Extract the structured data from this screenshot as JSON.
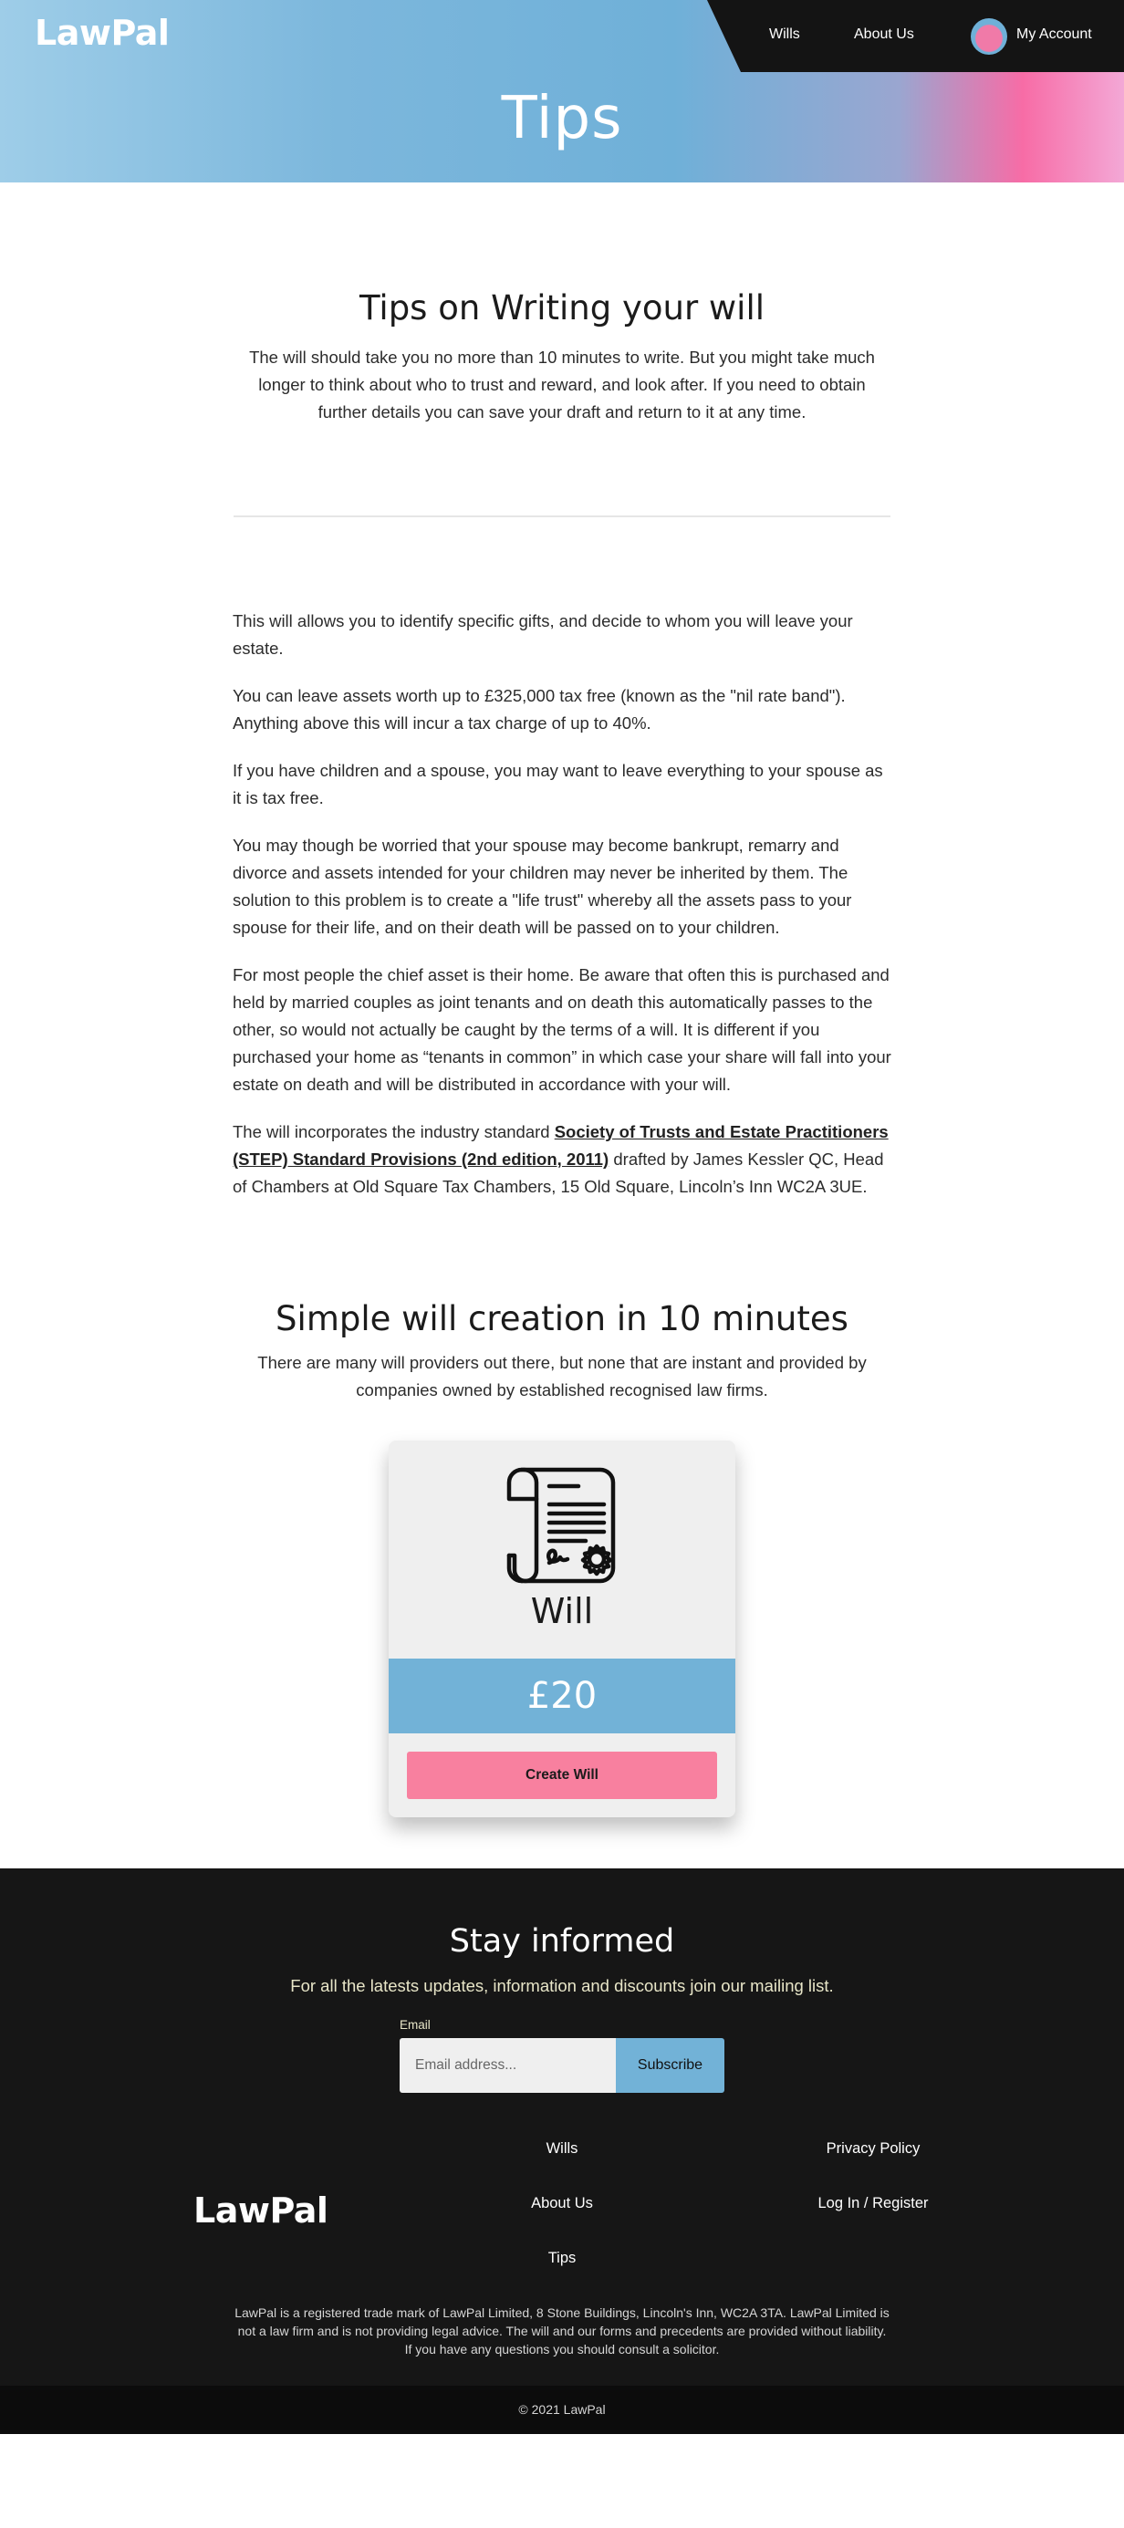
{
  "header": {
    "logo": "LawPal",
    "nav": {
      "wills": "Wills",
      "about": "About Us",
      "account": "My Account"
    },
    "page_title": "Tips"
  },
  "intro": {
    "heading": "Tips on Writing your will",
    "text": "The will should take you no more than 10 minutes to write. But you might take much longer to think about who to trust and reward, and look after. If you need to obtain further details you can save your draft and return to it at any time."
  },
  "tips": {
    "p1": "This will allows you to identify specific gifts, and decide to whom you will leave your estate.",
    "p2": "You can leave assets worth up to £325,000 tax free (known as the \"nil rate band\"). Anything above this will incur a tax charge of up to 40%.",
    "p3": "If you have children and a spouse, you may want to leave everything to your spouse as it is tax free.",
    "p4": "You may though be worried that your spouse may become bankrupt, remarry and divorce and assets intended for your children may never be inherited by them. The solution to this problem is to create a \"life trust\" whereby all the assets pass to your spouse for their life, and on their death will be passed on to your children.",
    "p5": "For most people the chief asset is their home. Be aware that often this is purchased and held by married couples as joint tenants and on death this automatically passes to the other, so would not actually be caught by the terms of a will. It is different if you purchased your home as “tenants in common” in which case your share will fall into your estate on death and will be distributed in accordance with your will.",
    "p6_before": "The will incorporates the industry standard ",
    "p6_link": "Society of Trusts and Estate Practitioners (STEP) Standard Provisions (2nd edition, 2011)",
    "p6_after": " drafted by James Kessler QC, Head of Chambers at Old Square Tax Chambers, 15 Old Square, Lincoln’s Inn WC2A 3UE."
  },
  "simple": {
    "heading": "Simple will creation in 10 minutes",
    "text": "There are many will providers out there, but none that are instant and provided by companies owned by established recognised law firms."
  },
  "card": {
    "icon": "will-scroll-icon",
    "title": "Will",
    "price": "£20",
    "button": "Create Will"
  },
  "newsletter": {
    "heading": "Stay informed",
    "text": "For all the latests updates, information and discounts join our mailing list.",
    "email_label": "Email",
    "email_placeholder": "Email address...",
    "subscribe": "Subscribe"
  },
  "footer": {
    "logo": "LawPal",
    "links": {
      "wills": "Wills",
      "about": "About Us",
      "tips": "Tips",
      "privacy": "Privacy Policy",
      "login": "Log In / Register"
    },
    "legal": "LawPal is a registered trade mark of LawPal Limited, 8 Stone Buildings, Lincoln's Inn, WC2A 3TA. LawPal Limited is not a law firm and is not providing legal advice. The will and our forms and precedents are provided without liability. If you have any questions you should consult a solicitor.",
    "copyright": "© 2021 LawPal"
  },
  "colors": {
    "accent_blue": "#72b2d7",
    "accent_pink": "#f8809f",
    "footer_bg": "#161616",
    "nav_bg": "#141414"
  }
}
